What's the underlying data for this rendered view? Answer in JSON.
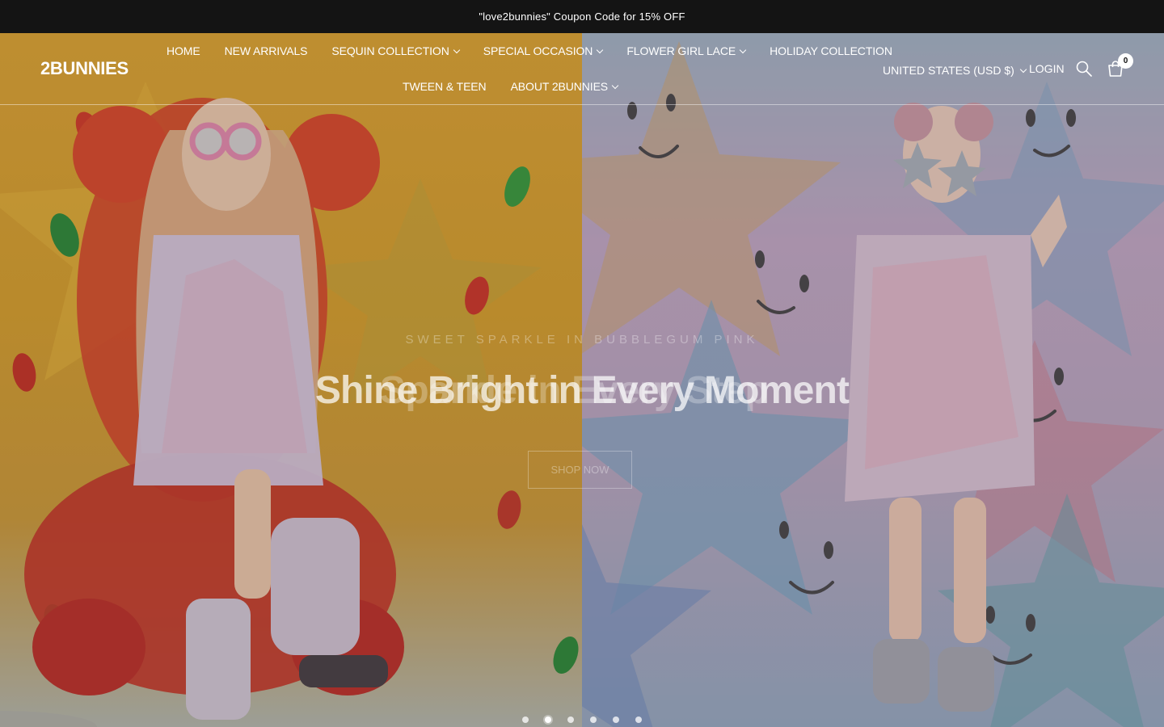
{
  "announcement": {
    "text": "\"love2bunnies\" Coupon Code for 15% OFF"
  },
  "header": {
    "logo": "2BUNNIES",
    "nav_row1": [
      {
        "label": "HOME",
        "has_dropdown": false
      },
      {
        "label": "NEW ARRIVALS",
        "has_dropdown": false
      },
      {
        "label": "SEQUIN COLLECTION",
        "has_dropdown": true
      },
      {
        "label": "SPECIAL OCCASION",
        "has_dropdown": true
      },
      {
        "label": "FLOWER GIRL LACE",
        "has_dropdown": true
      },
      {
        "label": "HOLIDAY COLLECTION",
        "has_dropdown": false
      }
    ],
    "nav_row2": [
      {
        "label": "TWEEN & TEEN",
        "has_dropdown": false
      },
      {
        "label": "ABOUT 2BUNNIES",
        "has_dropdown": true
      }
    ],
    "currency": "UNITED STATES (USD $)",
    "login": "LOGIN",
    "cart_count": "0"
  },
  "hero": {
    "subtitle": "SWEET SPARKLE IN BUBBLEGUM PINK",
    "headline": "Shine Bright in Every Moment",
    "headline_ghost": "Sparkle in Every Step",
    "cta": "SHOP NOW",
    "slides_total": 6,
    "active_slide": 2
  },
  "colors": {
    "announcement_bg": "#141414",
    "text": "#ffffff"
  }
}
